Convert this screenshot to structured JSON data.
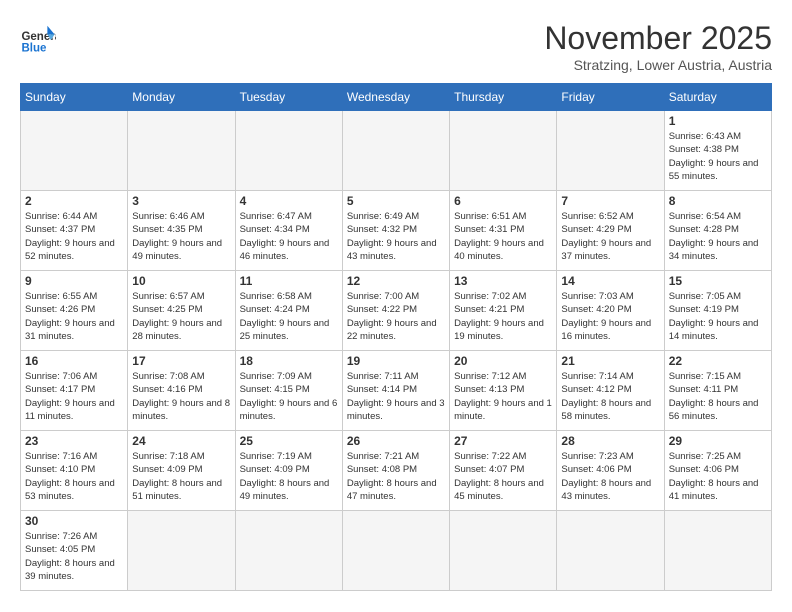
{
  "header": {
    "logo_general": "General",
    "logo_blue": "Blue",
    "month_title": "November 2025",
    "subtitle": "Stratzing, Lower Austria, Austria"
  },
  "days_of_week": [
    "Sunday",
    "Monday",
    "Tuesday",
    "Wednesday",
    "Thursday",
    "Friday",
    "Saturday"
  ],
  "weeks": [
    [
      {
        "day": "",
        "info": ""
      },
      {
        "day": "",
        "info": ""
      },
      {
        "day": "",
        "info": ""
      },
      {
        "day": "",
        "info": ""
      },
      {
        "day": "",
        "info": ""
      },
      {
        "day": "",
        "info": ""
      },
      {
        "day": "1",
        "info": "Sunrise: 6:43 AM\nSunset: 4:38 PM\nDaylight: 9 hours\nand 55 minutes."
      }
    ],
    [
      {
        "day": "2",
        "info": "Sunrise: 6:44 AM\nSunset: 4:37 PM\nDaylight: 9 hours\nand 52 minutes."
      },
      {
        "day": "3",
        "info": "Sunrise: 6:46 AM\nSunset: 4:35 PM\nDaylight: 9 hours\nand 49 minutes."
      },
      {
        "day": "4",
        "info": "Sunrise: 6:47 AM\nSunset: 4:34 PM\nDaylight: 9 hours\nand 46 minutes."
      },
      {
        "day": "5",
        "info": "Sunrise: 6:49 AM\nSunset: 4:32 PM\nDaylight: 9 hours\nand 43 minutes."
      },
      {
        "day": "6",
        "info": "Sunrise: 6:51 AM\nSunset: 4:31 PM\nDaylight: 9 hours\nand 40 minutes."
      },
      {
        "day": "7",
        "info": "Sunrise: 6:52 AM\nSunset: 4:29 PM\nDaylight: 9 hours\nand 37 minutes."
      },
      {
        "day": "8",
        "info": "Sunrise: 6:54 AM\nSunset: 4:28 PM\nDaylight: 9 hours\nand 34 minutes."
      }
    ],
    [
      {
        "day": "9",
        "info": "Sunrise: 6:55 AM\nSunset: 4:26 PM\nDaylight: 9 hours\nand 31 minutes."
      },
      {
        "day": "10",
        "info": "Sunrise: 6:57 AM\nSunset: 4:25 PM\nDaylight: 9 hours\nand 28 minutes."
      },
      {
        "day": "11",
        "info": "Sunrise: 6:58 AM\nSunset: 4:24 PM\nDaylight: 9 hours\nand 25 minutes."
      },
      {
        "day": "12",
        "info": "Sunrise: 7:00 AM\nSunset: 4:22 PM\nDaylight: 9 hours\nand 22 minutes."
      },
      {
        "day": "13",
        "info": "Sunrise: 7:02 AM\nSunset: 4:21 PM\nDaylight: 9 hours\nand 19 minutes."
      },
      {
        "day": "14",
        "info": "Sunrise: 7:03 AM\nSunset: 4:20 PM\nDaylight: 9 hours\nand 16 minutes."
      },
      {
        "day": "15",
        "info": "Sunrise: 7:05 AM\nSunset: 4:19 PM\nDaylight: 9 hours\nand 14 minutes."
      }
    ],
    [
      {
        "day": "16",
        "info": "Sunrise: 7:06 AM\nSunset: 4:17 PM\nDaylight: 9 hours\nand 11 minutes."
      },
      {
        "day": "17",
        "info": "Sunrise: 7:08 AM\nSunset: 4:16 PM\nDaylight: 9 hours\nand 8 minutes."
      },
      {
        "day": "18",
        "info": "Sunrise: 7:09 AM\nSunset: 4:15 PM\nDaylight: 9 hours\nand 6 minutes."
      },
      {
        "day": "19",
        "info": "Sunrise: 7:11 AM\nSunset: 4:14 PM\nDaylight: 9 hours\nand 3 minutes."
      },
      {
        "day": "20",
        "info": "Sunrise: 7:12 AM\nSunset: 4:13 PM\nDaylight: 9 hours\nand 1 minute."
      },
      {
        "day": "21",
        "info": "Sunrise: 7:14 AM\nSunset: 4:12 PM\nDaylight: 8 hours\nand 58 minutes."
      },
      {
        "day": "22",
        "info": "Sunrise: 7:15 AM\nSunset: 4:11 PM\nDaylight: 8 hours\nand 56 minutes."
      }
    ],
    [
      {
        "day": "23",
        "info": "Sunrise: 7:16 AM\nSunset: 4:10 PM\nDaylight: 8 hours\nand 53 minutes."
      },
      {
        "day": "24",
        "info": "Sunrise: 7:18 AM\nSunset: 4:09 PM\nDaylight: 8 hours\nand 51 minutes."
      },
      {
        "day": "25",
        "info": "Sunrise: 7:19 AM\nSunset: 4:09 PM\nDaylight: 8 hours\nand 49 minutes."
      },
      {
        "day": "26",
        "info": "Sunrise: 7:21 AM\nSunset: 4:08 PM\nDaylight: 8 hours\nand 47 minutes."
      },
      {
        "day": "27",
        "info": "Sunrise: 7:22 AM\nSunset: 4:07 PM\nDaylight: 8 hours\nand 45 minutes."
      },
      {
        "day": "28",
        "info": "Sunrise: 7:23 AM\nSunset: 4:06 PM\nDaylight: 8 hours\nand 43 minutes."
      },
      {
        "day": "29",
        "info": "Sunrise: 7:25 AM\nSunset: 4:06 PM\nDaylight: 8 hours\nand 41 minutes."
      }
    ],
    [
      {
        "day": "30",
        "info": "Sunrise: 7:26 AM\nSunset: 4:05 PM\nDaylight: 8 hours\nand 39 minutes."
      },
      {
        "day": "",
        "info": ""
      },
      {
        "day": "",
        "info": ""
      },
      {
        "day": "",
        "info": ""
      },
      {
        "day": "",
        "info": ""
      },
      {
        "day": "",
        "info": ""
      },
      {
        "day": "",
        "info": ""
      }
    ]
  ]
}
